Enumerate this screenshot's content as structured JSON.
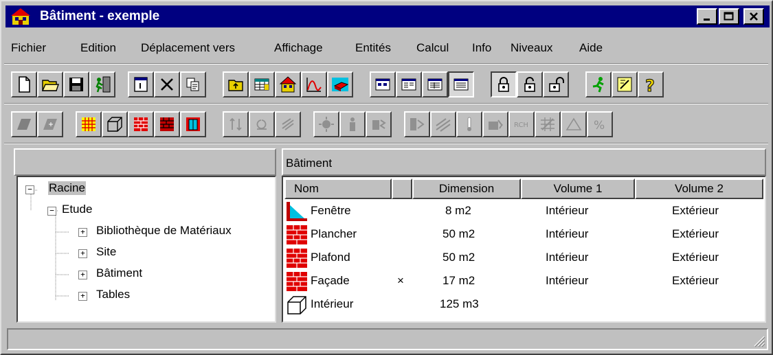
{
  "window": {
    "title": "Bâtiment - exemple",
    "minimize_label": "_",
    "maximize_label": "□",
    "close_label": "✕"
  },
  "menu": [
    "Fichier",
    "Edition",
    "Déplacement vers",
    "Affichage",
    "Entités",
    "Calcul",
    "Info",
    "Niveaux",
    "Aide"
  ],
  "toolbar1": [
    {
      "icon": "new-file-icon"
    },
    {
      "icon": "open-folder-icon"
    },
    {
      "icon": "save-disk-icon"
    },
    {
      "icon": "exit-run-icon"
    },
    {
      "icon": "properties-icon"
    },
    {
      "icon": "delete-x-icon"
    },
    {
      "icon": "copy-icon"
    },
    {
      "icon": "folder-up-icon"
    },
    {
      "icon": "tables-icon"
    },
    {
      "icon": "building-icon"
    },
    {
      "icon": "curve-chart-icon"
    },
    {
      "icon": "brick-block-icon"
    },
    {
      "icon": "view-small-icons-icon"
    },
    {
      "icon": "view-list-icon"
    },
    {
      "icon": "view-details-icon"
    },
    {
      "icon": "view-report-icon"
    },
    {
      "icon": "lock-closed-icon"
    },
    {
      "icon": "lock-half-icon"
    },
    {
      "icon": "lock-open-icon"
    },
    {
      "icon": "run-green-icon"
    },
    {
      "icon": "edit-note-icon"
    },
    {
      "icon": "help-question-icon"
    }
  ],
  "toolbar2": [
    {
      "icon": "wall-gray-icon"
    },
    {
      "icon": "wall-section-icon"
    },
    {
      "icon": "grid-yellow-icon"
    },
    {
      "icon": "cube-icon"
    },
    {
      "icon": "brick-wall-icon"
    },
    {
      "icon": "brick-red-icon"
    },
    {
      "icon": "window-frame-icon"
    },
    {
      "icon": "arrows-updown-icon"
    },
    {
      "icon": "rotate-icon"
    },
    {
      "icon": "fan-icon"
    },
    {
      "icon": "sun-icon"
    },
    {
      "icon": "person-icon"
    },
    {
      "icon": "machine-icon"
    },
    {
      "icon": "hvac-icon"
    },
    {
      "icon": "slope-icon"
    },
    {
      "icon": "thermometer-icon"
    },
    {
      "icon": "cooling-icon"
    },
    {
      "icon": "chemistry-icon"
    },
    {
      "icon": "percent-grid-icon"
    },
    {
      "icon": "triangle-icon"
    },
    {
      "icon": "percent-icon"
    }
  ],
  "tree": {
    "root": "Racine",
    "study": "Etude",
    "children": [
      "Bibliothèque de Matériaux",
      "Site",
      "Bâtiment",
      "Tables"
    ]
  },
  "list": {
    "header_title": "Bâtiment",
    "columns": [
      "Nom",
      "",
      "Dimension",
      "Volume 1",
      "Volume 2"
    ],
    "rows": [
      {
        "icon": "window-triangle-icon",
        "name": "Fenêtre",
        "flag": "",
        "dimension": "8 m2",
        "volume1": "Intérieur",
        "volume2": "Extérieur"
      },
      {
        "icon": "brick-wall-icon",
        "name": "Plancher",
        "flag": "",
        "dimension": "50 m2",
        "volume1": "Intérieur",
        "volume2": "Extérieur"
      },
      {
        "icon": "brick-wall-icon",
        "name": "Plafond",
        "flag": "",
        "dimension": "50 m2",
        "volume1": "Intérieur",
        "volume2": "Extérieur"
      },
      {
        "icon": "brick-wall-icon",
        "name": "Façade",
        "flag": "×",
        "dimension": "17 m2",
        "volume1": "Intérieur",
        "volume2": "Extérieur"
      },
      {
        "icon": "cube-outline-icon",
        "name": "Intérieur",
        "flag": "",
        "dimension": "125 m3",
        "volume1": "",
        "volume2": ""
      }
    ]
  },
  "status": {
    "text": ""
  }
}
